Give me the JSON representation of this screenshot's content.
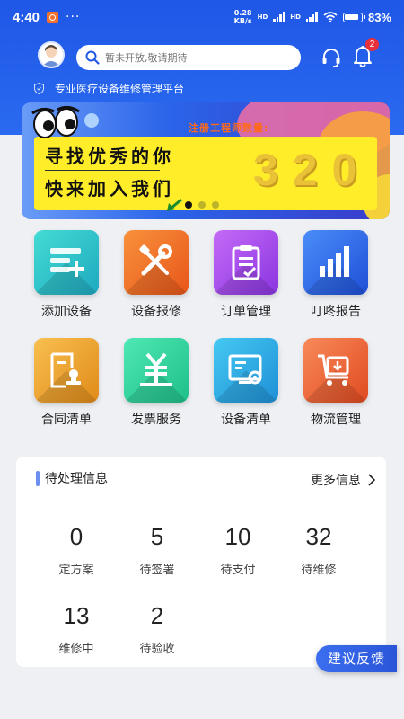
{
  "status_bar": {
    "time": "4:40",
    "dots": "···",
    "net_speed_value": "0.28",
    "net_speed_unit": "KB/s",
    "net_type_1": "HD",
    "net_type_2": "HD",
    "battery_pct": "83%"
  },
  "header": {
    "search_placeholder": "暂未开放,敬请期待",
    "notification_count": "2",
    "tagline": "专业医疗设备维修管理平台"
  },
  "banner": {
    "line1": "寻找优秀的你",
    "line2": "快来加入我们",
    "engineer_label": "注册工程师数量:",
    "engineer_count": "320",
    "slide_index": 0,
    "slide_total": 3
  },
  "grid": {
    "items": [
      {
        "label": "添加设备",
        "icon": "add-device-icon",
        "color": "#2cc5c5"
      },
      {
        "label": "设备报修",
        "icon": "repair-tools-icon",
        "color": "#f5762a"
      },
      {
        "label": "订单管理",
        "icon": "clipboard-check-icon",
        "color": "#a24df0"
      },
      {
        "label": "叮咚报告",
        "icon": "bar-chart-icon",
        "color": "#2f6cf0"
      },
      {
        "label": "合同清单",
        "icon": "contract-seal-icon",
        "color": "#f0a832"
      },
      {
        "label": "发票服务",
        "icon": "invoice-yen-icon",
        "color": "#2fd9a0"
      },
      {
        "label": "设备清单",
        "icon": "device-list-icon",
        "color": "#2bb0e8"
      },
      {
        "label": "物流管理",
        "icon": "logistics-cart-icon",
        "color": "#f06c3a"
      }
    ]
  },
  "pending": {
    "title": "待处理信息",
    "more_label": "更多信息",
    "stats": [
      {
        "value": "0",
        "label": "定方案"
      },
      {
        "value": "5",
        "label": "待签署"
      },
      {
        "value": "10",
        "label": "待支付"
      },
      {
        "value": "32",
        "label": "待维修"
      },
      {
        "value": "13",
        "label": "维修中"
      },
      {
        "value": "2",
        "label": "待验收"
      }
    ]
  },
  "feedback_label": "建议反馈",
  "colors": {
    "header_blue": "#1f57e6",
    "banner_yellow": "#ffed2a",
    "badge_red": "#e8303a",
    "accent_orange": "#ff6a1a"
  }
}
